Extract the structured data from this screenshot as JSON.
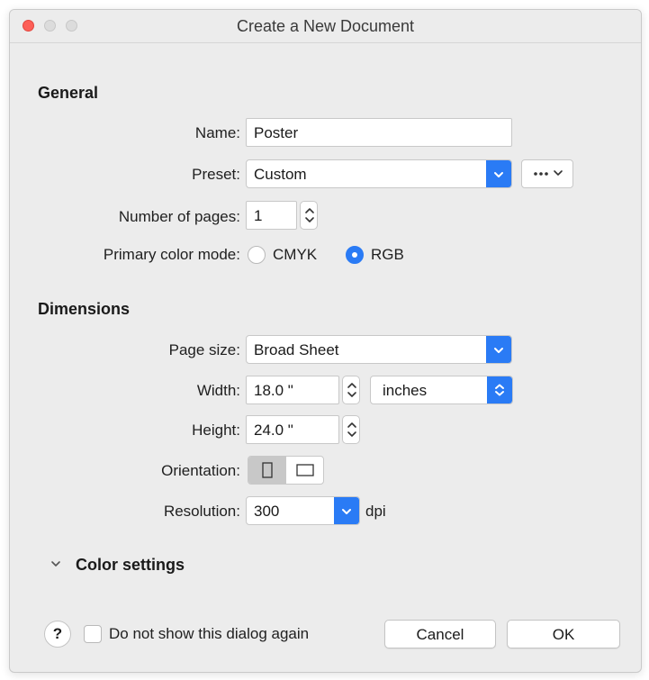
{
  "window": {
    "title": "Create a New Document"
  },
  "general": {
    "heading": "General",
    "name_label": "Name:",
    "name_value": "Poster",
    "preset_label": "Preset:",
    "preset_value": "Custom",
    "pages_label": "Number of pages:",
    "pages_value": "1",
    "color_mode_label": "Primary color mode:",
    "color_mode_options": [
      "CMYK",
      "RGB"
    ],
    "color_mode_selected": "RGB"
  },
  "dimensions": {
    "heading": "Dimensions",
    "page_size_label": "Page size:",
    "page_size_value": "Broad Sheet",
    "width_label": "Width:",
    "width_value": "18.0 \"",
    "units_value": "inches",
    "height_label": "Height:",
    "height_value": "24.0 \"",
    "orientation_label": "Orientation:",
    "orientation_selected": "portrait",
    "resolution_label": "Resolution:",
    "resolution_value": "300",
    "resolution_unit": "dpi"
  },
  "color_settings": {
    "heading": "Color settings",
    "expanded": false
  },
  "footer": {
    "help_label": "?",
    "dont_show_label": "Do not show this dialog again",
    "dont_show_checked": false,
    "cancel_label": "Cancel",
    "ok_label": "OK"
  },
  "colors": {
    "accent": "#2a7bf5",
    "close_button": "#fd5f57",
    "window_bg": "#ececec"
  }
}
